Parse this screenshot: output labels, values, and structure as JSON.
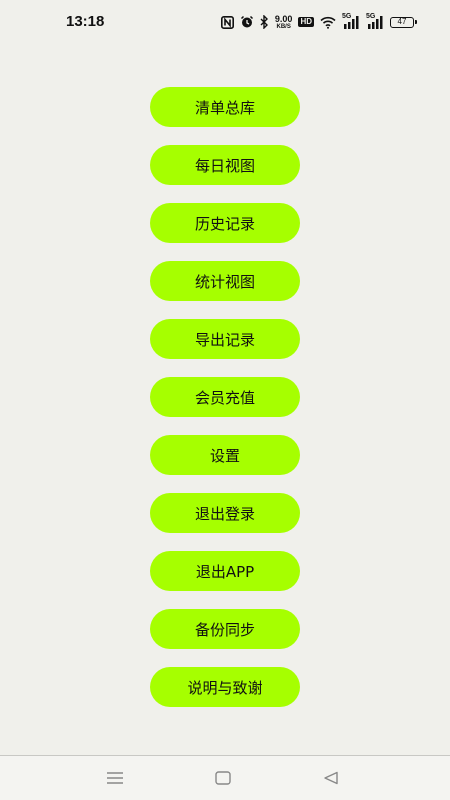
{
  "status_bar": {
    "time": "13:18",
    "net_speed_value": "9.00",
    "net_speed_unit": "KB/S",
    "hd_label": "HD",
    "sim1_label": "5G",
    "sim2_label": "5G",
    "battery_level": "47",
    "icons": [
      "nfc-icon",
      "alarm-icon",
      "bluetooth-icon",
      "wifi-icon",
      "signal-icon",
      "battery-icon"
    ]
  },
  "menu": {
    "items": [
      {
        "label": "清单总库"
      },
      {
        "label": "每日视图"
      },
      {
        "label": "历史记录"
      },
      {
        "label": "统计视图"
      },
      {
        "label": "导出记录"
      },
      {
        "label": "会员充值"
      },
      {
        "label": "设置"
      },
      {
        "label": "退出登录"
      },
      {
        "label": "退出APP"
      },
      {
        "label": "备份同步"
      },
      {
        "label": "说明与致谢"
      }
    ],
    "button_color": "#a6ff00"
  },
  "nav_bar": {
    "icons": [
      "menu-icon",
      "home-icon",
      "back-icon"
    ]
  },
  "colors": {
    "background": "#f0f0eb",
    "accent": "#a6ff00"
  }
}
